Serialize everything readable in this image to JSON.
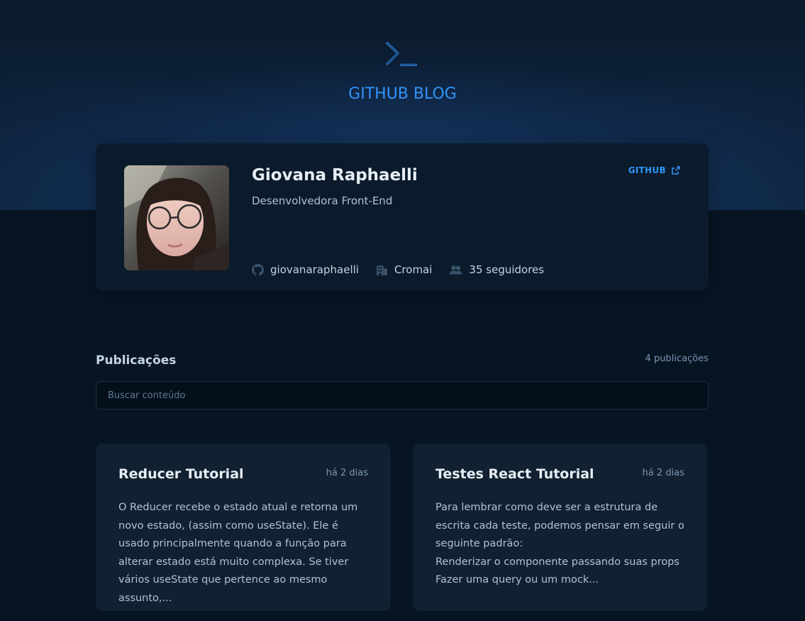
{
  "header": {
    "logo_icon": "terminal-prompt-icon",
    "title": "GITHUB BLOG"
  },
  "profile": {
    "name": "Giovana Raphaelli",
    "role": "Desenvolvedora Front-End",
    "github_label": "GITHUB",
    "github_icon": "external-link-icon",
    "stats": [
      {
        "icon": "github-icon",
        "label": "giovanaraphaelli"
      },
      {
        "icon": "building-icon",
        "label": "Cromai"
      },
      {
        "icon": "user-group-icon",
        "label": "35 seguidores"
      }
    ]
  },
  "publications": {
    "title": "Publicações",
    "count": "4 publicações",
    "search_placeholder": "Buscar conteúdo"
  },
  "posts": [
    {
      "title": "Reducer Tutorial",
      "date": "há 2 dias",
      "excerpt": "O Reducer recebe o estado atual e retorna um novo estado, (assim como useState). Ele é usado principalmente quando a função para alterar estado está muito complexa. Se tiver vários useState que pertence ao mesmo assunto,..."
    },
    {
      "title": "Testes React Tutorial",
      "date": "há 2 dias",
      "excerpt": "Para lembrar como deve ser a estrutura de escrita cada teste, podemos pensar em seguir o seguinte padrão:\nRenderizar o componente passando suas props\nFazer uma query ou um mock..."
    }
  ],
  "colors": {
    "accent": "#3294F8",
    "background": "#071422",
    "card": "#112131",
    "profile_card": "#0B1B2B"
  }
}
